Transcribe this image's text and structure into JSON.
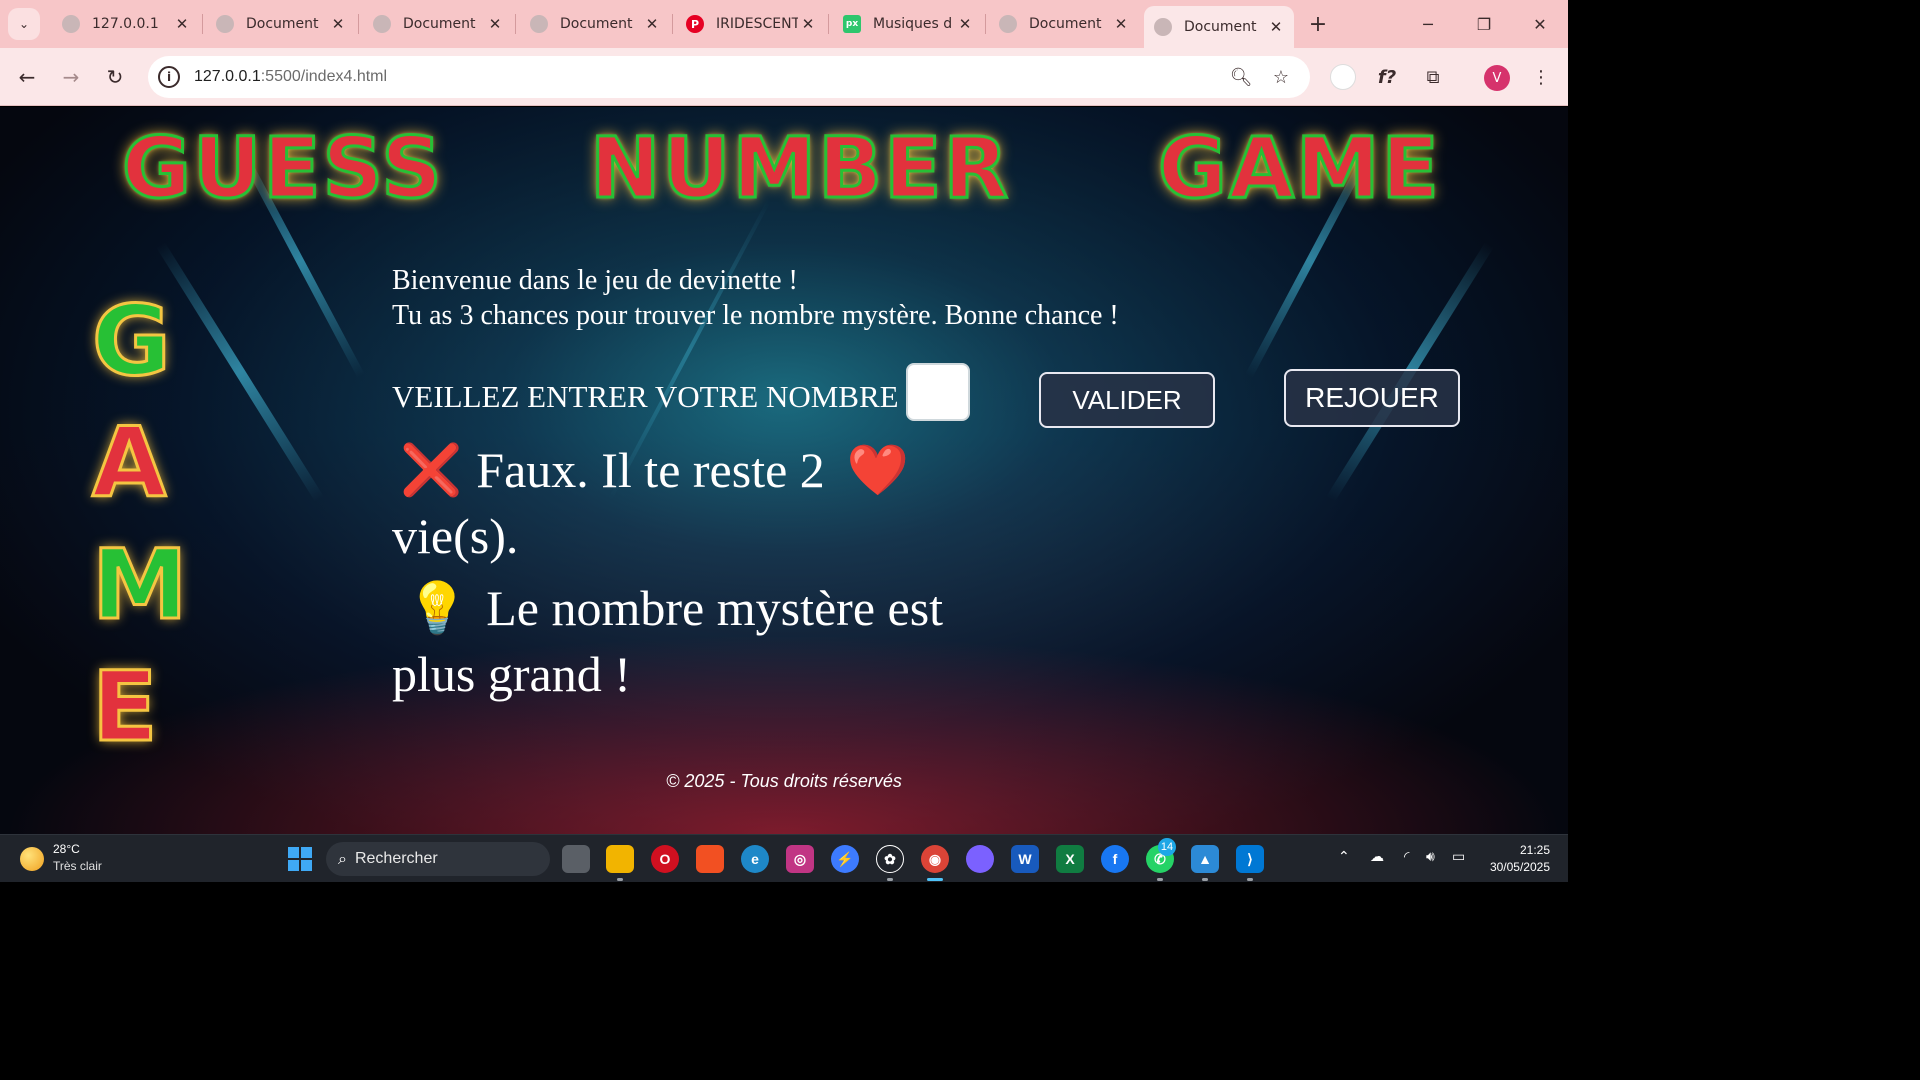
{
  "browser": {
    "tabs": [
      {
        "title": "127.0.0.1",
        "favicon": "globe-icon"
      },
      {
        "title": "Document",
        "favicon": "globe-icon"
      },
      {
        "title": "Document",
        "favicon": "globe-icon"
      },
      {
        "title": "Document",
        "favicon": "globe-icon"
      },
      {
        "title": "IRIDESCENT",
        "favicon": "pinterest-icon"
      },
      {
        "title": "Musiques d",
        "favicon": "pixabay-icon"
      },
      {
        "title": "Document",
        "favicon": "globe-icon"
      },
      {
        "title": "Document",
        "favicon": "globe-icon",
        "active": true
      }
    ],
    "address": {
      "host": "127.0.0.1",
      "path": ":5500/index4.html"
    },
    "profile_initial": "V",
    "theme_color": "#f7c6c8"
  },
  "page": {
    "title_words": [
      "GUESS",
      "NUMBER",
      "GAME"
    ],
    "side_letters": [
      "G",
      "A",
      "M",
      "E"
    ],
    "intro_line1": "Bienvenue dans le jeu de devinette !",
    "intro_line2": "Tu as 3 chances pour trouver le nombre mystère. Bonne chance !",
    "prompt": "VEILLEZ ENTRER VOTRE NOMBRE :",
    "input_value": "",
    "validate_label": "VALIDER",
    "replay_label": "REJOUER",
    "result_icon": "❌",
    "result_text": "Faux. Il te reste 2",
    "result_heart": "❤️",
    "result_tail": "vie(s).",
    "hint_icon": "💡",
    "hint_text": "Le nombre mystère est plus grand !",
    "footer": "© 2025 - Tous droits réservés",
    "colors": {
      "title_fill": "#e2323d",
      "title_outline": "#27c035",
      "glow": "#ffc83c"
    }
  },
  "taskbar": {
    "weather_temp": "28°C",
    "weather_desc": "Très clair",
    "search_label": "Rechercher",
    "whatsapp_badge": "14",
    "time": "21:25",
    "date": "30/05/2025"
  }
}
